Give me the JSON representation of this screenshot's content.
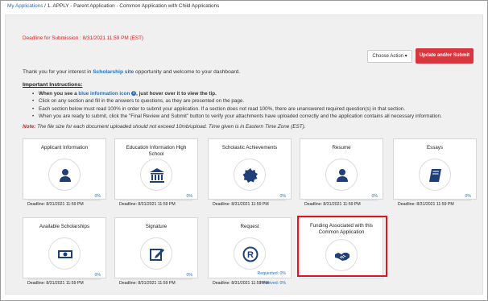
{
  "breadcrumb": {
    "link": "My Applications",
    "rest": " / 1. APPLY - Parent Application - Common Application with Child Applications"
  },
  "deadline_text": "Deadline for Submission : 8/31/2021 11:59 PM (EST)",
  "actions": {
    "choose_action": "Choose Action ▾",
    "update_submit": "Update and/or Submit"
  },
  "welcome": {
    "before": "Thank you for your interest in ",
    "site": "Scholarship site",
    "after": " opportunity and welcome to your dashboard."
  },
  "instructions": {
    "title": "Important Instructions:",
    "item1_before": "When you see a ",
    "item1_blue": "blue information icon",
    "item1_after": ", just hover over it to view the tip.",
    "item2": "Click on any section and fill in the answers to questions, as they are presented on the page.",
    "item3": "Each section below must read 100% in order to submit your application. If a section does not read 100%, there are unanswered required question(s) in that section.",
    "item4": "When you are ready to submit, click the \"Final Review and Submit\" button to verify your attachments have uploaded correctly and the application contains all necessary information."
  },
  "note": {
    "label": "Note:",
    "text": " The file size for each document uploaded should not exceed 10mb/upload. Time given is in Eastern Time Zone (EST)."
  },
  "cards": [
    {
      "title": "Applicant Information",
      "icon": "person-icon",
      "percent": "0%",
      "deadline": "Deadline: 8/31/2021 11:59 PM"
    },
    {
      "title": "Education Information High School",
      "icon": "institution-icon",
      "percent": "0%",
      "deadline": "Deadline: 8/31/2021 11:59 PM"
    },
    {
      "title": "Scholastic Achievements",
      "icon": "seal-icon",
      "percent": "0%",
      "deadline": "Deadline: 8/31/2021 11:59 PM"
    },
    {
      "title": "Resume",
      "icon": "person-icon",
      "percent": "0%",
      "deadline": "Deadline: 8/31/2021 11:59 PM"
    },
    {
      "title": "Essays",
      "icon": "book-icon",
      "percent": "0%",
      "deadline": "Deadline: 8/31/2021 11:59 PM"
    },
    {
      "title": "Available Scholarships",
      "icon": "money-icon",
      "percent": "0%",
      "deadline": "Deadline: 8/31/2021 11:59 PM"
    },
    {
      "title": "Signature",
      "icon": "edit-icon",
      "percent": "0%",
      "deadline": "Deadline: 8/31/2021 11:59 PM"
    },
    {
      "title": "Request",
      "icon": "registered-icon",
      "requested": "Requested: 0%",
      "received": "Received: 0%",
      "deadline": "Deadline: 8/31/2021 11:59 PM"
    },
    {
      "title": "Funding Associated with this Common Application",
      "icon": "handshake-icon"
    }
  ],
  "colors": {
    "accent_blue": "#2a6ebb",
    "icon_navy": "#1f3f7a",
    "submit_red": "#d9363e",
    "highlight_red": "#e0161e"
  }
}
